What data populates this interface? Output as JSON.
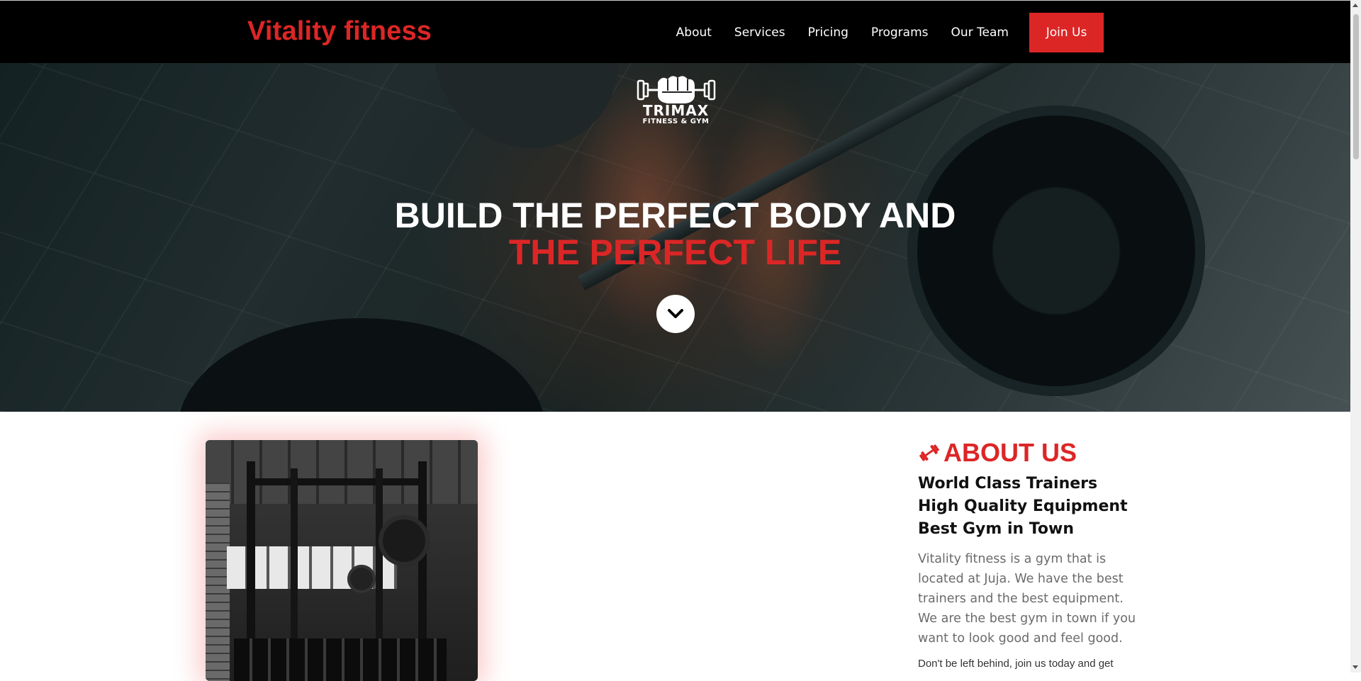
{
  "nav": {
    "brand": "Vitality fitness",
    "links": [
      "About",
      "Services",
      "Pricing",
      "Programs",
      "Our Team"
    ],
    "cta": "Join Us"
  },
  "hero": {
    "logo_name": "TRIMAX",
    "logo_sub": "FITNESS & GYM",
    "title_line1": "BUILD THE PERFECT BODY AND",
    "title_line2": "THE PERFECT LIFE"
  },
  "about": {
    "heading": "ABOUT US",
    "subheadings": [
      "World Class Trainers",
      "High Quality Equipment",
      "Best Gym in Town"
    ],
    "body": "Vitality fitness is a gym that is located at Juja. We have the best trainers and the best equipment. We are the best gym in town if you want to look good and feel good.",
    "note": "Don't be left behind, join us today and get"
  },
  "colors": {
    "accent": "#dc2626",
    "nav_bg": "#000000",
    "text_muted": "#6b6b6b"
  },
  "icons": {
    "scroll": "chevron-down-icon",
    "about": "dumbbell-icon",
    "logo": "fist-dumbbell-icon"
  }
}
